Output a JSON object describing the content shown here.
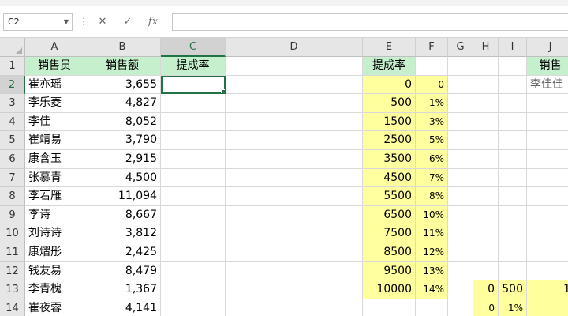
{
  "formula_bar": {
    "name_box": "C2",
    "cancel_icon": "✕",
    "enter_icon": "✓",
    "function_icon": "fx",
    "formula": ""
  },
  "colors": {
    "header_green": "#c6efce",
    "table_yellow": "#ffff9d",
    "selection": "#217346"
  },
  "columns": [
    "A",
    "B",
    "C",
    "D",
    "E",
    "F",
    "G",
    "H",
    "I",
    "J"
  ],
  "rows": [
    "1",
    "2",
    "3",
    "4",
    "5",
    "6",
    "7",
    "8",
    "9",
    "10",
    "11",
    "12",
    "13",
    "14"
  ],
  "headers": {
    "salesperson": "销售员",
    "sales_amount": "销售额",
    "commission_rate": "提成率",
    "lookup_title": "提成率",
    "j_header": "销售"
  },
  "sales_rows": [
    {
      "name": "崔亦瑶",
      "amount": "3,655"
    },
    {
      "name": "李乐菱",
      "amount": "4,827"
    },
    {
      "name": "李佳",
      "amount": "8,052"
    },
    {
      "name": "崔靖易",
      "amount": "3,790"
    },
    {
      "name": "康含玉",
      "amount": "2,915"
    },
    {
      "name": "张慕青",
      "amount": "4,500"
    },
    {
      "name": "李若雁",
      "amount": "11,094"
    },
    {
      "name": "李诗",
      "amount": "8,667"
    },
    {
      "name": "刘诗诗",
      "amount": "3,812"
    },
    {
      "name": "康熠彤",
      "amount": "2,425"
    },
    {
      "name": "钱友易",
      "amount": "8,479"
    },
    {
      "name": "李青槐",
      "amount": "1,367"
    },
    {
      "name": "崔夜蓉",
      "amount": "4,141"
    }
  ],
  "rate_table": [
    {
      "threshold": "0",
      "rate": "0"
    },
    {
      "threshold": "500",
      "rate": "1%"
    },
    {
      "threshold": "1500",
      "rate": "3%"
    },
    {
      "threshold": "2500",
      "rate": "5%"
    },
    {
      "threshold": "3500",
      "rate": "6%"
    },
    {
      "threshold": "4500",
      "rate": "7%"
    },
    {
      "threshold": "5500",
      "rate": "8%"
    },
    {
      "threshold": "6500",
      "rate": "10%"
    },
    {
      "threshold": "7500",
      "rate": "11%"
    },
    {
      "threshold": "8500",
      "rate": "12%"
    },
    {
      "threshold": "9500",
      "rate": "13%"
    },
    {
      "threshold": "10000",
      "rate": "14%"
    }
  ],
  "extra": {
    "j2": "李佳佳",
    "h13": "0",
    "i13": "500",
    "j13": "1",
    "h14": "0",
    "i14": "1%"
  }
}
